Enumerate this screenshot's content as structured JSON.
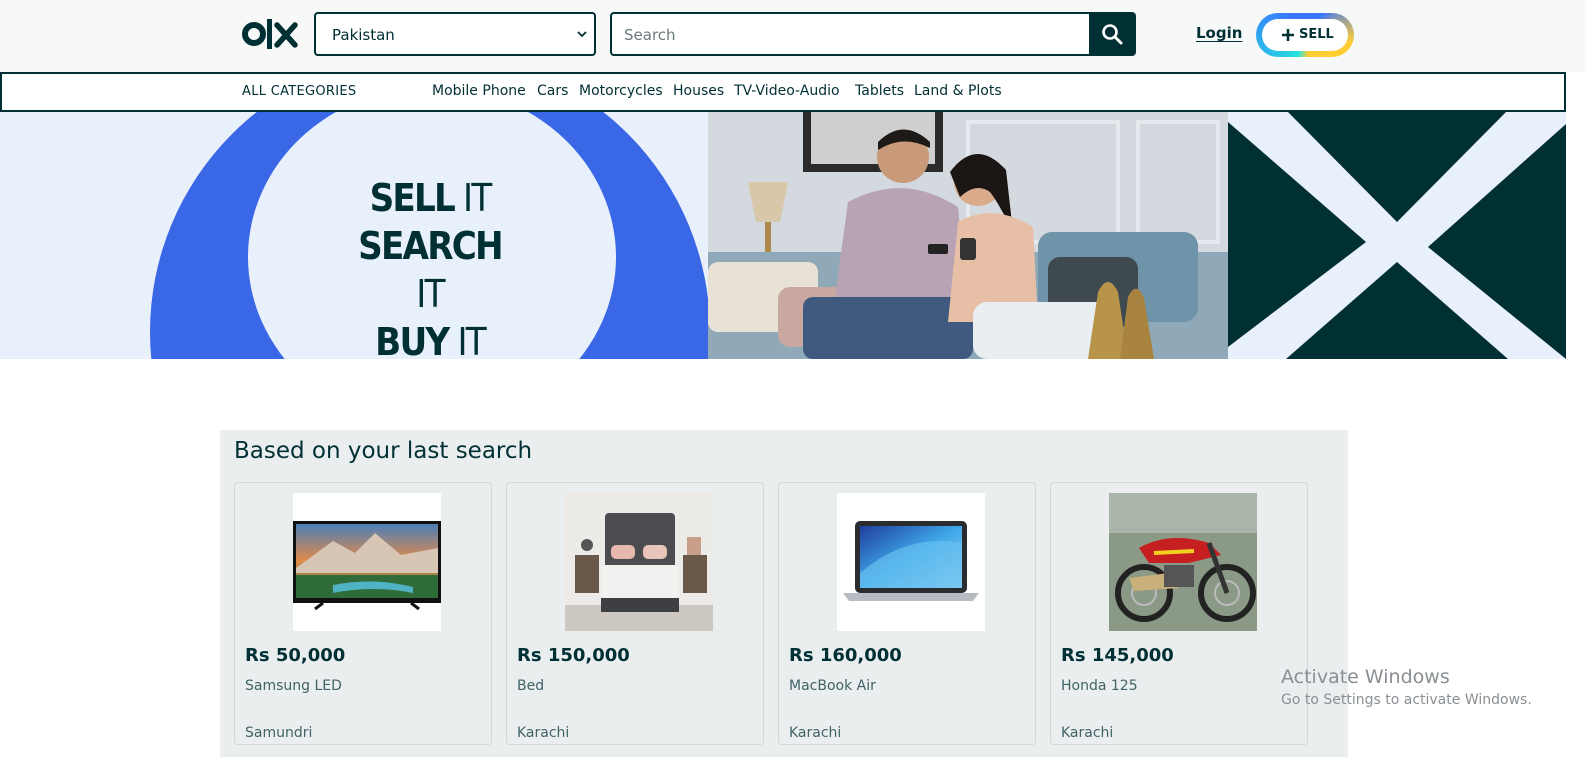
{
  "header": {
    "logo_text": "olx",
    "location": {
      "selected": "Pakistan"
    },
    "search": {
      "placeholder": "Search"
    },
    "login_label": "Login",
    "sell_label": "SELL"
  },
  "categories": {
    "all_label": "ALL CATEGORIES",
    "items": [
      "Mobile Phone",
      "Cars",
      "Motorcycles",
      "Houses",
      "TV-Video-Audio",
      "Tablets",
      "Land & Plots"
    ]
  },
  "hero": {
    "lines": [
      {
        "bold": "SELL",
        "light": " IT"
      },
      {
        "bold": "SEARCH",
        "light": " IT"
      },
      {
        "bold": "BUY",
        "light": " IT"
      }
    ]
  },
  "recommendations": {
    "title": "Based on your last search",
    "cards": [
      {
        "price": "Rs 50,000",
        "name": "Samsung LED",
        "location": "Samundri",
        "image": "tv-image"
      },
      {
        "price": "Rs 150,000",
        "name": "Bed",
        "location": "Karachi",
        "image": "bed-image"
      },
      {
        "price": "Rs 160,000",
        "name": "MacBook Air",
        "location": "Karachi",
        "image": "laptop-image"
      },
      {
        "price": "Rs 145,000",
        "name": "Honda 125",
        "location": "Karachi",
        "image": "motorcycle-image"
      }
    ]
  },
  "watermark": {
    "line1": "Activate Windows",
    "line2": "Go to Settings to activate Windows."
  },
  "colors": {
    "brand_dark": "#002f34",
    "brand_blue": "#3a67e6",
    "background_light": "#e8f0fc",
    "section_gray": "#ebeeef"
  },
  "icons": {
    "search": "search-icon",
    "chevron": "chevron-down-icon",
    "plus": "plus-icon"
  }
}
